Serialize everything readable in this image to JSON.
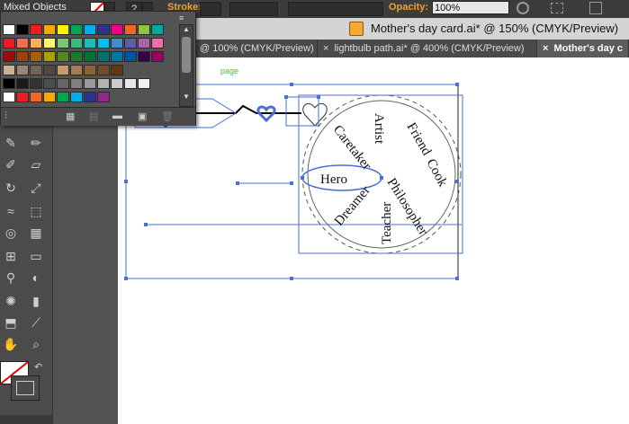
{
  "controlbar": {
    "selection": "Mixed Objects",
    "stroke_label": "Stroke:",
    "opacity_label": "Opacity:",
    "opacity_value": "100%",
    "help_glyph": "?"
  },
  "document": {
    "title": "Mother's day card.ai* @ 150% (CMYK/Preview)"
  },
  "tabs": [
    {
      "label": "@ 100% (CMYK/Preview)",
      "close": "×"
    },
    {
      "label": "lightbulb path.ai* @ 400% (CMYK/Preview)",
      "close": "×"
    },
    {
      "label": "Mother's day c",
      "close": "×"
    }
  ],
  "canvas": {
    "page_label": "page",
    "words": [
      "Artist",
      "Friend",
      "Caretaker",
      "Cook",
      "Hero",
      "Philosopher",
      "Dreamer",
      "Teacher"
    ]
  },
  "colors": {
    "selection": "#4a6fd8",
    "accent": "#f0a030",
    "page_label": "#2fcf2f"
  },
  "swatches": {
    "row1": [
      "#ffffff",
      "#000000",
      "#ee1c25",
      "#f7a900",
      "#fff200",
      "#00a651",
      "#00aeef",
      "#2e3192",
      "#ec008c",
      "#f26522",
      "#8dc63f",
      "#00a99d"
    ],
    "row2": [
      "#ed1c24",
      "#f26c4f",
      "#fbaf5d",
      "#fff568",
      "#7cc576",
      "#3cb878",
      "#1cbbb4",
      "#00bff3",
      "#448ccb",
      "#605ca8",
      "#a864a8",
      "#f06eaa"
    ],
    "row3": [
      "#9e0b0f",
      "#a0410d",
      "#a36209",
      "#aba000",
      "#598527",
      "#1a7b30",
      "#007236",
      "#00746b",
      "#0076a3",
      "#0054a6",
      "#32004b",
      "#9e005d"
    ],
    "row4": [
      "#c7b299",
      "#998675",
      "#736357",
      "#534741",
      "#c69c6d",
      "#a67c52",
      "#8c6239",
      "#754c24",
      "#603913"
    ],
    "row5": [
      "#000000",
      "#1a1a1a",
      "#333333",
      "#4d4d4d",
      "#666666",
      "#808080",
      "#999999",
      "#b3b3b3",
      "#cccccc",
      "#e6e6e6",
      "#f2f2f2"
    ],
    "row6": [
      "#ffffff",
      "#ee1c25",
      "#f26522",
      "#f7a900",
      "#00a651",
      "#00aeef",
      "#2e3192",
      "#92278f"
    ]
  }
}
